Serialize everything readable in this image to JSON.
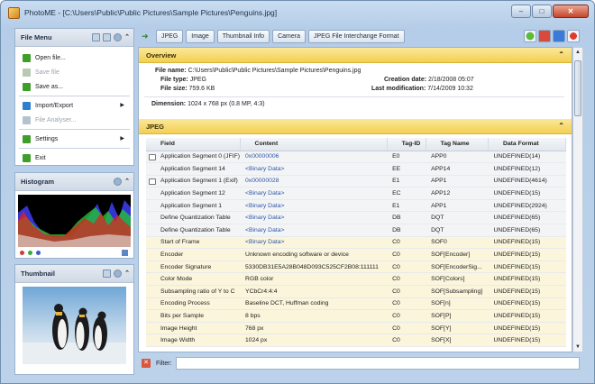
{
  "window": {
    "title": "PhotoME - [C:\\Users\\Public\\Public Pictures\\Sample Pictures\\Penguins.jpg]",
    "controls": {
      "minimize": "–",
      "maximize": "□",
      "close": "✕"
    }
  },
  "file_menu": {
    "title": "File Menu",
    "items": [
      {
        "label": "Open file...",
        "enabled": true,
        "icon": "open-icon"
      },
      {
        "label": "Save file",
        "enabled": false,
        "icon": "save-icon"
      },
      {
        "label": "Save as...",
        "enabled": true,
        "icon": "save-as-icon"
      },
      {
        "label": "Import/Export",
        "enabled": true,
        "icon": "import-export-icon"
      },
      {
        "label": "File Analyser...",
        "enabled": false,
        "icon": "analyser-icon"
      },
      {
        "label": "Settings",
        "enabled": true,
        "icon": "settings-icon"
      },
      {
        "label": "Exit",
        "enabled": true,
        "icon": "exit-icon"
      }
    ]
  },
  "histogram": {
    "title": "Histogram"
  },
  "thumbnail": {
    "title": "Thumbnail"
  },
  "tabs": [
    "JPEG",
    "Image",
    "Thumbnail Info",
    "Camera",
    "JPEG File Interchange Format"
  ],
  "overview": {
    "title": "Overview",
    "file_name_label": "File name:",
    "file_name": "C:\\Users\\Public\\Public Pictures\\Sample Pictures\\Penguins.jpg",
    "file_type_label": "File type:",
    "file_type": "JPEG",
    "file_size_label": "File size:",
    "file_size": "759.6 KB",
    "creation_label": "Creation date:",
    "creation_date": "2/18/2008 05:07",
    "modification_label": "Last modification:",
    "modification_date": "7/14/2009 10:32",
    "dimension_label": "Dimension:",
    "dimension": "1024 x 768 px (0.8 MP, 4:3)"
  },
  "jpeg": {
    "title": "JPEG",
    "columns": [
      "Field",
      "Content",
      "Tag-ID",
      "Tag Name",
      "Data Format"
    ],
    "rows": [
      {
        "field": "Application Segment 0 (JFIF)",
        "content": "0x00000006",
        "tag_id": "E0",
        "tag_name": "APP0",
        "format": "UNDEFINED(14)",
        "link": true,
        "expand": true,
        "kind": "seg"
      },
      {
        "field": "Application Segment 14",
        "content": "<Binary Data>",
        "tag_id": "EE",
        "tag_name": "APP14",
        "format": "UNDEFINED(12)",
        "link": true,
        "expand": false,
        "kind": "seg"
      },
      {
        "field": "Application Segment 1 (Exif)",
        "content": "0x00000028",
        "tag_id": "E1",
        "tag_name": "APP1",
        "format": "UNDEFINED(4614)",
        "link": true,
        "expand": true,
        "kind": "seg"
      },
      {
        "field": "Application Segment 12",
        "content": "<Binary Data>",
        "tag_id": "EC",
        "tag_name": "APP12",
        "format": "UNDEFINED(15)",
        "link": true,
        "expand": false,
        "kind": "seg"
      },
      {
        "field": "Application Segment 1",
        "content": "<Binary Data>",
        "tag_id": "E1",
        "tag_name": "APP1",
        "format": "UNDEFINED(2924)",
        "link": true,
        "expand": false,
        "kind": "seg"
      },
      {
        "field": "Define Quantization Table",
        "content": "<Binary Data>",
        "tag_id": "DB",
        "tag_name": "DQT",
        "format": "UNDEFINED(65)",
        "link": true,
        "expand": false,
        "kind": "seg"
      },
      {
        "field": "Define Quantization Table",
        "content": "<Binary Data>",
        "tag_id": "DB",
        "tag_name": "DQT",
        "format": "UNDEFINED(65)",
        "link": true,
        "expand": false,
        "kind": "seg"
      },
      {
        "field": "Start of Frame",
        "content": "<Binary Data>",
        "tag_id": "C0",
        "tag_name": "SOF0",
        "format": "UNDEFINED(15)",
        "link": true,
        "expand": false,
        "kind": "sof"
      },
      {
        "field": "Encoder",
        "content": "Unknown encoding software or device",
        "tag_id": "C0",
        "tag_name": "SOF[Encoder]",
        "format": "UNDEFINED(15)",
        "link": false,
        "expand": false,
        "kind": "sof"
      },
      {
        "field": "Encoder Signature",
        "content": "5330DB31E5A28B048D093C525CF2B08:111111",
        "tag_id": "C0",
        "tag_name": "SOF[EncoderSig...",
        "format": "UNDEFINED(15)",
        "link": false,
        "expand": false,
        "kind": "sof"
      },
      {
        "field": "Color Mode",
        "content": "RGB color",
        "tag_id": "C0",
        "tag_name": "SOF[Colors]",
        "format": "UNDEFINED(15)",
        "link": false,
        "expand": false,
        "kind": "sof"
      },
      {
        "field": "Subsampling ratio of Y to C",
        "content": "YCbCr4:4:4",
        "tag_id": "C0",
        "tag_name": "SOF[Subsampling]",
        "format": "UNDEFINED(15)",
        "link": false,
        "expand": false,
        "kind": "sof"
      },
      {
        "field": "Encoding Process",
        "content": "Baseline DCT, Huffman coding",
        "tag_id": "C0",
        "tag_name": "SOF[n]",
        "format": "UNDEFINED(15)",
        "link": false,
        "expand": false,
        "kind": "sof"
      },
      {
        "field": "Bits per Sample",
        "content": "8 bps",
        "tag_id": "C0",
        "tag_name": "SOF[P]",
        "format": "UNDEFINED(15)",
        "link": false,
        "expand": false,
        "kind": "sof"
      },
      {
        "field": "Image Height",
        "content": "768 px",
        "tag_id": "C0",
        "tag_name": "SOF[Y]",
        "format": "UNDEFINED(15)",
        "link": false,
        "expand": false,
        "kind": "sof"
      },
      {
        "field": "Image Width",
        "content": "1024 px",
        "tag_id": "C0",
        "tag_name": "SOF[X]",
        "format": "UNDEFINED(15)",
        "link": false,
        "expand": false,
        "kind": "sof"
      }
    ]
  },
  "filter": {
    "label": "Filter:",
    "value": "",
    "clear_icon": "✕"
  },
  "colors": {
    "accent_link": "#2d57a7",
    "section_header": "#f3cf52",
    "sof_row": "#fbf5dc"
  }
}
